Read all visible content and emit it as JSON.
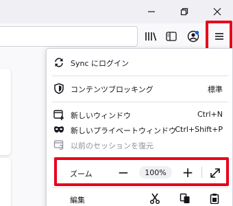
{
  "window": {
    "icons": [
      "minimize-icon",
      "restore-icon",
      "close-icon"
    ]
  },
  "toolbar": {
    "icons": [
      "library-icon",
      "sidebar-icon",
      "account-icon",
      "hamburger-menu-icon"
    ]
  },
  "menu": {
    "sync_label": "Sync にログイン",
    "content_blocking_label": "コンテンツブロッキング",
    "content_blocking_value": "標準",
    "new_window_label": "新しいウィンドウ",
    "new_window_shortcut": "Ctrl+N",
    "new_private_label": "新しいプライベートウィンドウ",
    "new_private_shortcut": "Ctrl+Shift+P",
    "restore_session_label": "以前のセッションを復元",
    "zoom_label": "ズーム",
    "zoom_minus": "−",
    "zoom_value": "100%",
    "zoom_plus": "+",
    "edit_label": "編集"
  },
  "colors": {
    "highlight": "#e8001b"
  }
}
